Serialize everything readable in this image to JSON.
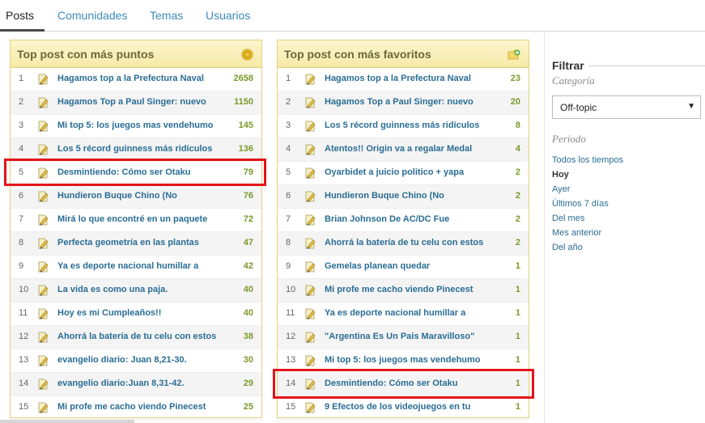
{
  "tabs": [
    {
      "label": "Posts",
      "active": true
    },
    {
      "label": "Comunidades",
      "active": false
    },
    {
      "label": "Temas",
      "active": false
    },
    {
      "label": "Usuarios",
      "active": false
    }
  ],
  "panels": [
    {
      "title": "Top post con más puntos",
      "header_icon": "coin-icon",
      "rows": [
        {
          "rank": "1",
          "title": "Hagamos top a la Prefectura Naval",
          "score": "2658"
        },
        {
          "rank": "2",
          "title": "Hagamos Top a Paul Singer: nuevo",
          "score": "1150"
        },
        {
          "rank": "3",
          "title": "Mi top 5: los juegos mas vendehumo",
          "score": "145"
        },
        {
          "rank": "4",
          "title": "Los 5 récord guinness más ridículos",
          "score": "136"
        },
        {
          "rank": "5",
          "title": "Desmintiendo: Cómo ser Otaku",
          "score": "79"
        },
        {
          "rank": "6",
          "title": "Hundieron Buque Chino (No",
          "score": "76"
        },
        {
          "rank": "7",
          "title": "Mirá lo que encontré en un paquete",
          "score": "72"
        },
        {
          "rank": "8",
          "title": "Perfecta geometría en las plantas",
          "score": "47"
        },
        {
          "rank": "9",
          "title": "Ya es deporte nacional humillar a",
          "score": "42"
        },
        {
          "rank": "10",
          "title": "La vida es como una paja.",
          "score": "40"
        },
        {
          "rank": "11",
          "title": "Hoy es mi Cumpleaños!!",
          "score": "40"
        },
        {
          "rank": "12",
          "title": "Ahorrá la batería de tu celu con estos",
          "score": "38"
        },
        {
          "rank": "13",
          "title": "evangelio diario: Juan 8,21-30.",
          "score": "30"
        },
        {
          "rank": "14",
          "title": "evangelio diario:Juan 8,31-42.",
          "score": "29"
        },
        {
          "rank": "15",
          "title": "Mi profe me cacho viendo Pinecest",
          "score": "25"
        }
      ]
    },
    {
      "title": "Top post con más favoritos",
      "header_icon": "add-favorite-icon",
      "rows": [
        {
          "rank": "1",
          "title": "Hagamos top a la Prefectura Naval",
          "score": "23"
        },
        {
          "rank": "2",
          "title": "Hagamos Top a Paul Singer: nuevo",
          "score": "20"
        },
        {
          "rank": "3",
          "title": "Los 5 récord guinness más ridículos",
          "score": "8"
        },
        {
          "rank": "4",
          "title": "Atentos!! Origin va a regalar Medal",
          "score": "4"
        },
        {
          "rank": "5",
          "title": "Oyarbidet a juicio politico + yapa",
          "score": "2"
        },
        {
          "rank": "6",
          "title": "Hundieron Buque Chino (No",
          "score": "2"
        },
        {
          "rank": "7",
          "title": "Brian Johnson De AC/DC Fue",
          "score": "2"
        },
        {
          "rank": "8",
          "title": "Ahorrá la batería de tu celu con estos",
          "score": "2"
        },
        {
          "rank": "9",
          "title": "Gemelas planean quedar",
          "score": "1"
        },
        {
          "rank": "10",
          "title": "Mi profe me cacho viendo Pinecest",
          "score": "1"
        },
        {
          "rank": "11",
          "title": "Ya es deporte nacional humillar a",
          "score": "1"
        },
        {
          "rank": "12",
          "title": "\"Argentina Es Un Pais Maravilloso\"",
          "score": "1"
        },
        {
          "rank": "13",
          "title": "Mi top 5: los juegos mas vendehumo",
          "score": "1"
        },
        {
          "rank": "14",
          "title": "Desmintiendo: Cómo ser Otaku",
          "score": "1"
        },
        {
          "rank": "15",
          "title": "9 Efectos de los videojuegos en tu",
          "score": "1"
        }
      ]
    }
  ],
  "sidebar": {
    "title": "Filtrar",
    "category_label": "Categoría",
    "category_value": "Off-topic",
    "period_label": "Período",
    "periods": [
      {
        "label": "Todos los tiempos",
        "active": false
      },
      {
        "label": "Hoy",
        "active": true
      },
      {
        "label": "Ayer",
        "active": false
      },
      {
        "label": "Últimos 7 días",
        "active": false
      },
      {
        "label": "Del mes",
        "active": false
      },
      {
        "label": "Mes anterior",
        "active": false
      },
      {
        "label": "Del año",
        "active": false
      }
    ]
  },
  "colors": {
    "link": "#2a6d94",
    "score": "#7a9a2a",
    "highlight": "#e4141b",
    "panel_border": "#e3cf7a"
  }
}
